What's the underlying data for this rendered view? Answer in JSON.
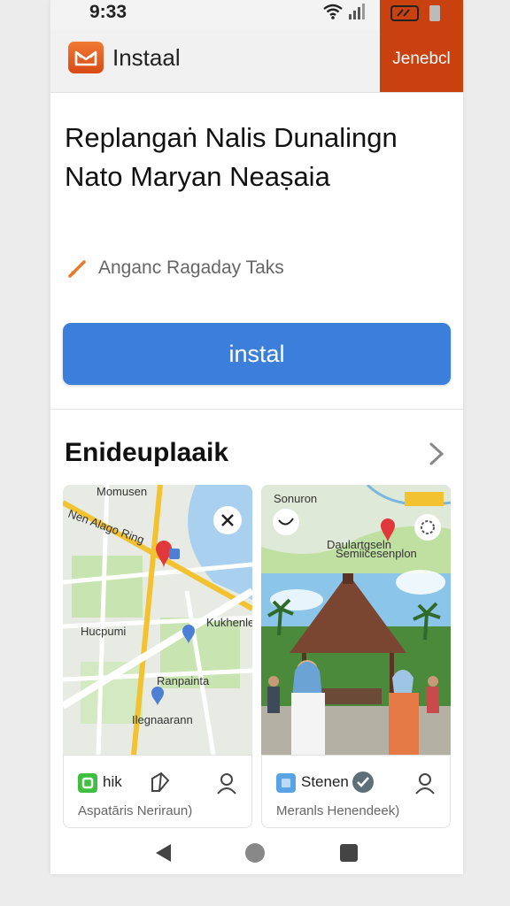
{
  "status_bar": {
    "time": "9:33"
  },
  "app_bar": {
    "title": "Instaal",
    "action_label": "Jenebcl"
  },
  "listing": {
    "title": "Replangaṅ Nalis Dunalingn Nato Maryan Neaṣaia",
    "subtitle": "Anganc Ragaday Taks",
    "install_label": "instal"
  },
  "section": {
    "title": "Enideuplaaik"
  },
  "cards": [
    {
      "footer_label": "hik",
      "footer_sub": "Aspatāris Neriraun)",
      "map_labels": [
        "Momusen",
        "Nen Alago Ring",
        "Hucpumi",
        "Kukhenler",
        "Ranpainta",
        "Ilegnaarann"
      ]
    },
    {
      "footer_label": "Stenen",
      "footer_sub": "Meranls Henendeek)",
      "map_labels": [
        "Sonuron",
        "Daulartgseln",
        "Semiicesenplon"
      ]
    }
  ],
  "colors": {
    "accent": "#3c7fdb",
    "brand": "#c8410f",
    "map_road": "#f2c230",
    "map_park": "#bfe3a4"
  },
  "icons": [
    "app-logo-icon",
    "wifi-icon",
    "signal-icon",
    "battery-icon",
    "pencil-icon",
    "chevron-right-icon",
    "map-pin-icon",
    "share-icon",
    "person-icon",
    "back-icon",
    "home-icon",
    "recents-icon"
  ]
}
